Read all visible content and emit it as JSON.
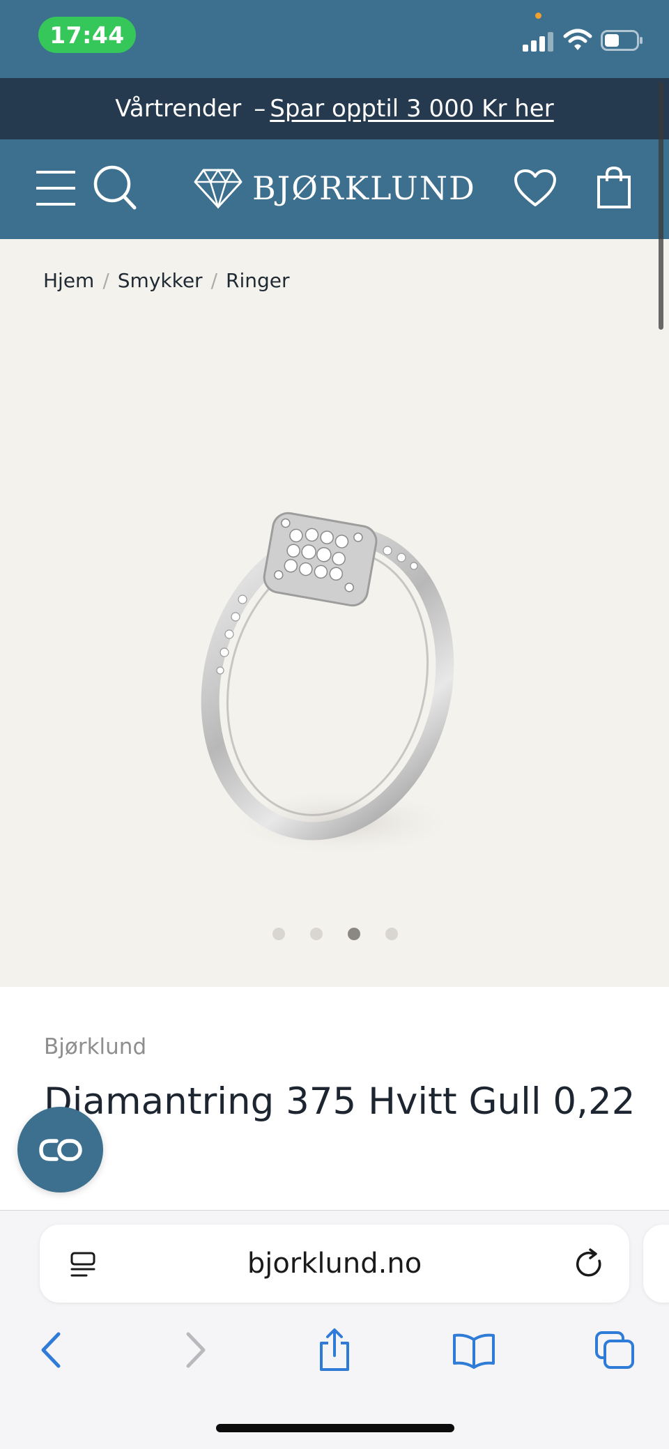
{
  "status_bar": {
    "time": "17:44",
    "signal_icon": "cellular-signal-icon",
    "wifi_icon": "wifi-icon",
    "battery_icon": "battery-icon"
  },
  "promo": {
    "text": "Vårtrender",
    "separator": "–",
    "link": "Spar opptil 3 000 Kr her"
  },
  "header": {
    "brand": "BJØRKLUND",
    "icons": [
      "menu-icon",
      "search-icon",
      "diamond-logo-icon",
      "heart-icon",
      "shopping-bag-icon"
    ]
  },
  "breadcrumb": {
    "items": [
      "Hjem",
      "Smykker",
      "Ringer"
    ],
    "separator": "/"
  },
  "gallery": {
    "image_count": 4,
    "active_index": 2
  },
  "product": {
    "brand": "Bjørklund",
    "title": "Diamantring 375 Hvitt Gull 0,22"
  },
  "browser": {
    "url": "bjorklund.no",
    "toolbar_icons": [
      "back-icon",
      "forward-icon",
      "share-icon",
      "bookmarks-icon",
      "tabs-icon"
    ]
  },
  "colors": {
    "header": "#3d6f8e",
    "promo": "#25394f",
    "gallery_bg": "#f4f2ed",
    "status_green": "#35c759"
  }
}
